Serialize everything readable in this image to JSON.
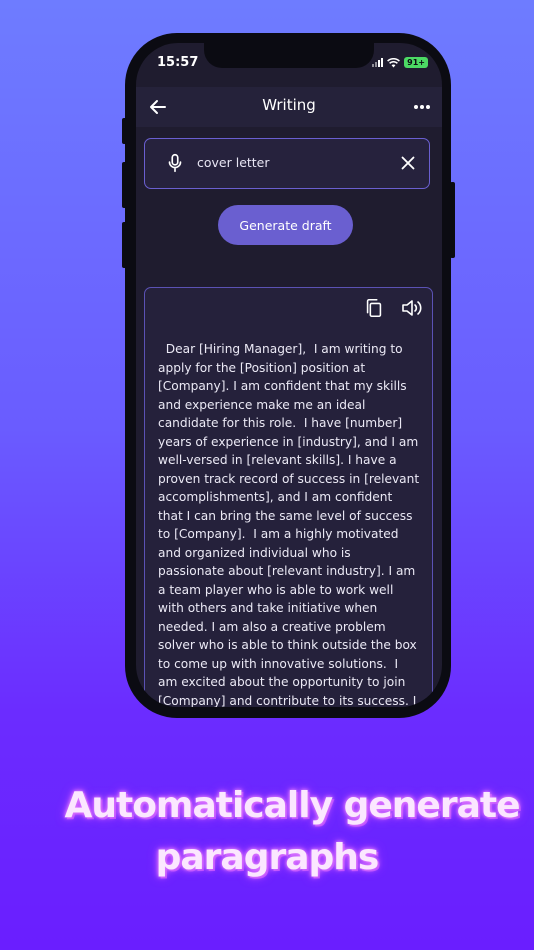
{
  "status_bar": {
    "time": "15:57",
    "battery": "91+"
  },
  "header": {
    "title": "Writing"
  },
  "search": {
    "value": "cover letter"
  },
  "generate_button": {
    "label": "Generate draft"
  },
  "output": {
    "text": "  Dear [Hiring Manager],  I am writing to apply for the [Position] position at [Company]. I am confident that my skills and experience make me an ideal candidate for this role.  I have [number] years of experience in [industry], and I am well-versed in [relevant skills]. I have a proven track record of success in [relevant accomplishments], and I am confident that I can bring the same level of success to [Company].  I am a highly motivated and organized individual who is passionate about [relevant industry]. I am a team player who is able to work well with others and take initiative when needed. I am also a creative problem solver who is able to think outside the box to come up with innovative solutions.  I am excited about the opportunity to join [Company] and contribute to its success. I am confident"
  },
  "caption": {
    "line1": "Automatically generate",
    "line2": "paragraphs"
  },
  "colors": {
    "accent": "#6a5fd0",
    "screen_bg": "#1f1c2f",
    "battery": "#4cd964"
  }
}
